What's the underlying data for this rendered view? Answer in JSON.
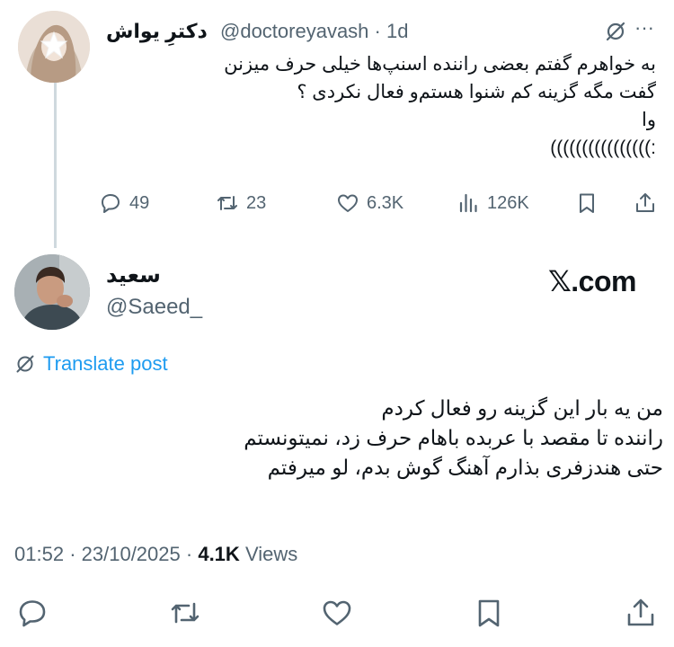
{
  "parent_post": {
    "display_name": "دکترِ یواش",
    "handle": "@doctoreyavash",
    "separator": "·",
    "time": "1d",
    "more_label": "···",
    "lines": [
      "به خواهرم گفتم بعضی راننده اسنپ‌ها خیلی حرف میزنن",
      "گفت مگه گزینه کم شنوا هستم‌و فعال نکردی ؟",
      "وا",
      ":))))))))))))))))"
    ],
    "actions": {
      "replies": "49",
      "reposts": "23",
      "likes": "6.3K",
      "views": "126K"
    },
    "icons": [
      "grok-icon",
      "more-icon",
      "reply-icon",
      "repost-icon",
      "like-icon",
      "views-icon",
      "bookmark-icon",
      "share-icon"
    ]
  },
  "main_post": {
    "display_name": "سعید",
    "handle": "@Saeed_",
    "watermark": "𝕏.com",
    "translate_label": "Translate post",
    "lines": [
      "من یه بار این گزینه رو فعال کردم",
      "راننده تا مقصد با عربده باهام حرف زد، نمیتونستم",
      "حتی هندزفری بذارم آهنگ گوش بدم، لو میرفتم"
    ],
    "time": "01:52",
    "date": "23/10/2025",
    "dot": "·",
    "views_count": "4.1K",
    "views_label": "Views"
  },
  "bottom_actions": [
    "reply-icon",
    "repost-icon",
    "like-icon",
    "bookmark-icon",
    "share-icon"
  ],
  "colors": {
    "text": "#0f1419",
    "secondary": "#536471",
    "link": "#1d9bf0",
    "thread_line": "#cfd9de"
  }
}
